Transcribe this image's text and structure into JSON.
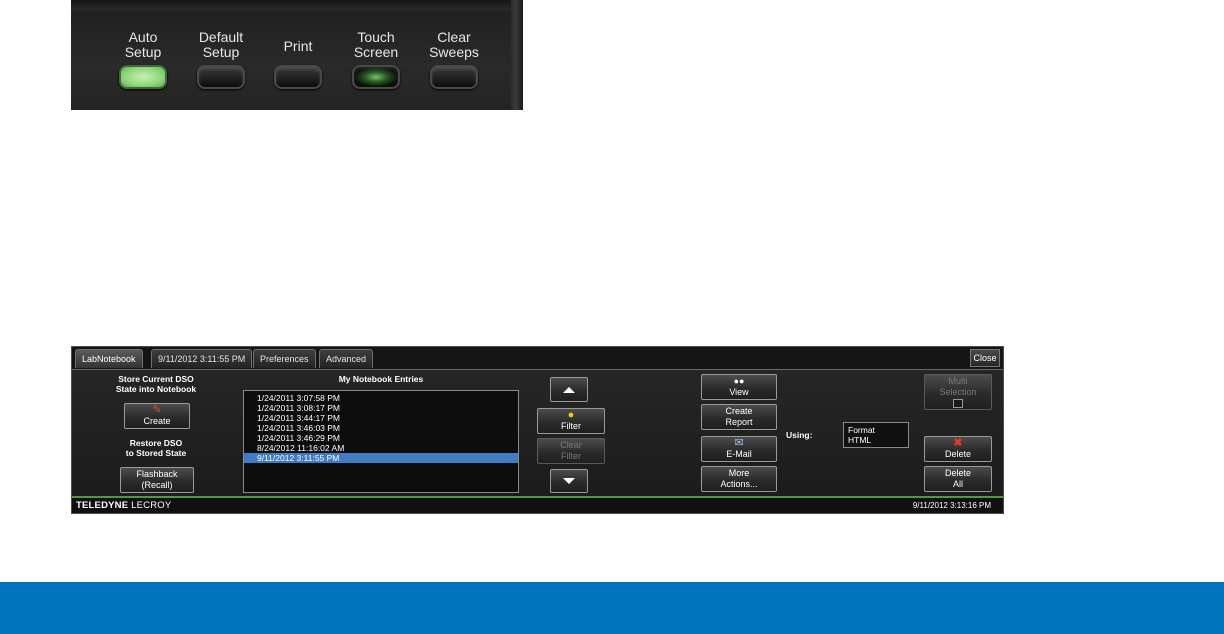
{
  "front_panel": {
    "buttons": [
      {
        "label": "Auto\nSetup",
        "state": "lit"
      },
      {
        "label": "Default\nSetup",
        "state": "off"
      },
      {
        "label": "Print",
        "state": "off"
      },
      {
        "label": "Touch\nScreen",
        "state": "glow"
      },
      {
        "label": "Clear\nSweeps",
        "state": "off"
      }
    ]
  },
  "tabs": [
    "LabNotebook",
    "9/11/2012 3:11:55 PM",
    "Preferences",
    "Advanced"
  ],
  "close_label": "Close",
  "left": {
    "store_heading": "Store Current DSO\nState into Notebook",
    "create_label": "Create",
    "restore_heading": "Restore DSO\nto Stored State",
    "flashback_label": "Flashback\n(Recall)"
  },
  "entries": {
    "heading": "My Notebook Entries",
    "items": [
      "1/24/2011 3:07:58 PM",
      "1/24/2011 3:08:17 PM",
      "1/24/2011 3:44:17 PM",
      "1/24/2011 3:46:03 PM",
      "1/24/2011 3:46:29 PM",
      "8/24/2012 11:16:02 AM",
      "9/11/2012 3:11:55 PM"
    ],
    "selected_index": 6
  },
  "middle": {
    "filter_label": "Filter",
    "clear_filter_label": "Clear\nFilter"
  },
  "actions": {
    "view_label": "View",
    "create_report_label": "Create\nReport",
    "email_label": "E-Mail",
    "more_actions_label": "More\nActions...",
    "using_label": "Using:",
    "format_label": "Format",
    "format_value": "HTML"
  },
  "right": {
    "multi_selection_label": "Multi\nSelection",
    "delete_label": "Delete",
    "delete_all_label": "Delete\nAll"
  },
  "status": {
    "brand_bold": "TELEDYNE",
    "brand_light": " LECROY",
    "datetime": "9/11/2012 3:13:16 PM"
  },
  "colors": {
    "selection": "#3f7cc4",
    "status_accent": "#4f9b3a",
    "footer_band": "#0073bc",
    "led_green": "#8fd67b"
  }
}
